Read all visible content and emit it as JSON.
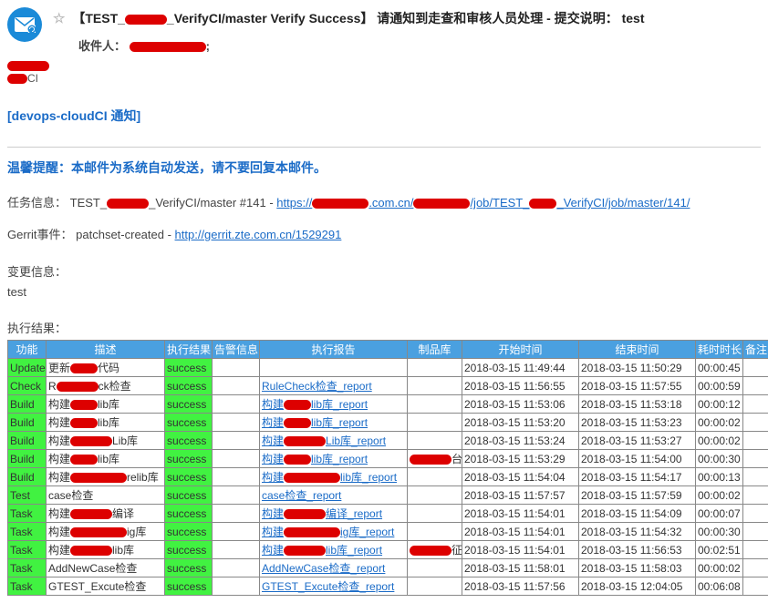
{
  "header": {
    "subject_prefix": "【TEST_",
    "subject_suffix": "_VerifyCI/master Verify Success】 请通知到走查和审核人员处理 - 提交说明： test",
    "recipient_label": "收件人：",
    "sender_suffix": "CI"
  },
  "cloud_ci": "[devops-cloudCI 通知]",
  "warm_tip": "温馨提醒：本邮件为系统自动发送，请不要回复本邮件。",
  "task_info": {
    "label": "任务信息：",
    "name_prefix": "TEST_",
    "name_suffix": "_VerifyCI/master #141 - ",
    "url_prefix": "https://",
    "url_mid1": ".com.cn/",
    "url_mid2": "/job/TEST_",
    "url_suffix": "_VerifyCI/job/master/141/"
  },
  "gerrit": {
    "label": "Gerrit事件：",
    "event": "patchset-created - ",
    "url": "http://gerrit.zte.com.cn/1529291"
  },
  "change_info_label": "变更信息：",
  "change_info_value": "test",
  "exec_result_label": "执行结果：",
  "columns": {
    "func": "功能",
    "desc": "描述",
    "status": "执行结果",
    "alert": "告警信息",
    "report": "执行报告",
    "repo": "制品库",
    "start": "开始时间",
    "end": "结束时间",
    "dur": "耗时时长",
    "remark": "备注"
  },
  "rows": [
    {
      "func": "Update",
      "desc_pre": "更新",
      "desc_suf": "代码",
      "red": "sm",
      "status": "success",
      "report": "",
      "repo": "",
      "start": "2018-03-15 11:49:44",
      "end": "2018-03-15 11:50:29",
      "dur": "00:00:45"
    },
    {
      "func": "Check",
      "desc_pre": "R",
      "desc_suf": "ck检查",
      "red": "md",
      "status": "success",
      "report": "RuleCheck检查_report",
      "repo": "",
      "start": "2018-03-15 11:56:55",
      "end": "2018-03-15 11:57:55",
      "dur": "00:00:59"
    },
    {
      "func": "Build",
      "desc_pre": "构建",
      "desc_suf": "lib库",
      "red": "sm",
      "status": "success",
      "report_pre": "构建",
      "report_suf": "lib库_report",
      "report_red": "sm",
      "repo": "",
      "start": "2018-03-15 11:53:06",
      "end": "2018-03-15 11:53:18",
      "dur": "00:00:12"
    },
    {
      "func": "Build",
      "desc_pre": "构建",
      "desc_suf": "lib库",
      "red": "sm",
      "status": "success",
      "report_pre": "构建",
      "report_suf": "lib库_report",
      "report_red": "sm",
      "repo": "",
      "start": "2018-03-15 11:53:20",
      "end": "2018-03-15 11:53:23",
      "dur": "00:00:02"
    },
    {
      "func": "Build",
      "desc_pre": "构建",
      "desc_suf": "Lib库",
      "red": "md",
      "status": "success",
      "report_pre": "构建",
      "report_suf": "Lib库_report",
      "report_red": "md",
      "repo": "",
      "start": "2018-03-15 11:53:24",
      "end": "2018-03-15 11:53:27",
      "dur": "00:00:02"
    },
    {
      "func": "Build",
      "desc_pre": "构建",
      "desc_suf": "lib库",
      "red": "sm",
      "status": "success",
      "report_pre": "构建",
      "report_suf": "lib库_report",
      "report_red": "sm",
      "repo_red": "md",
      "repo_suf": "台库",
      "start": "2018-03-15 11:53:29",
      "end": "2018-03-15 11:54:00",
      "dur": "00:00:30"
    },
    {
      "func": "Build",
      "desc_pre": "构建",
      "desc_suf": "relib库",
      "red": "lg",
      "status": "success",
      "report_pre": "构建",
      "report_suf": "lib库_report",
      "report_red": "lg",
      "repo": "",
      "start": "2018-03-15 11:54:04",
      "end": "2018-03-15 11:54:17",
      "dur": "00:00:13"
    },
    {
      "func": "Test",
      "desc_pre": "case检查",
      "desc_suf": "",
      "red": "",
      "status": "success",
      "report": "case检查_report",
      "repo": "",
      "start": "2018-03-15 11:57:57",
      "end": "2018-03-15 11:57:59",
      "dur": "00:00:02"
    },
    {
      "func": "Task",
      "desc_pre": "构建",
      "desc_suf": "编译",
      "red": "md",
      "status": "success",
      "report_pre": "构建",
      "report_suf": "编译_report",
      "report_red": "md",
      "repo": "",
      "start": "2018-03-15 11:54:01",
      "end": "2018-03-15 11:54:09",
      "dur": "00:00:07"
    },
    {
      "func": "Task",
      "desc_pre": "构建",
      "desc_suf": "ig库",
      "red": "lg",
      "status": "success",
      "report_pre": "构建",
      "report_suf": "ig库_report",
      "report_red": "lg",
      "repo": "",
      "start": "2018-03-15 11:54:01",
      "end": "2018-03-15 11:54:32",
      "dur": "00:00:30"
    },
    {
      "func": "Task",
      "desc_pre": "构建",
      "desc_suf": "lib库",
      "red": "md",
      "status": "success",
      "report_pre": "构建",
      "report_suf": "lib库_report",
      "report_red": "md",
      "repo_red": "md",
      "repo_suf": "征库",
      "start": "2018-03-15 11:54:01",
      "end": "2018-03-15 11:56:53",
      "dur": "00:02:51"
    },
    {
      "func": "Task",
      "desc_pre": "AddNewCase检查",
      "desc_suf": "",
      "red": "",
      "status": "success",
      "report": "AddNewCase检查_report",
      "repo": "",
      "start": "2018-03-15 11:58:01",
      "end": "2018-03-15 11:58:03",
      "dur": "00:00:02"
    },
    {
      "func": "Task",
      "desc_pre": "GTEST_Excute检查",
      "desc_suf": "",
      "red": "",
      "status": "success",
      "report": "GTEST_Excute检查_report",
      "repo": "",
      "start": "2018-03-15 11:57:56",
      "end": "2018-03-15 12:04:05",
      "dur": "00:06:08"
    }
  ]
}
